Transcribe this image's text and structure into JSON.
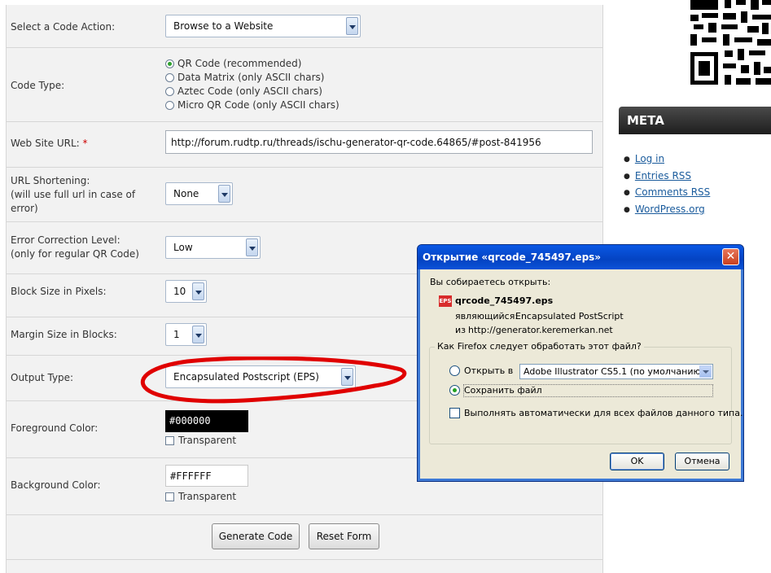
{
  "form": {
    "code_action": {
      "label": "Select a Code Action:",
      "value": "Browse to a Website"
    },
    "code_type": {
      "label": "Code Type:",
      "options": [
        {
          "label": "QR Code (recommended)",
          "selected": true
        },
        {
          "label": "Data Matrix (only ASCII chars)",
          "selected": false
        },
        {
          "label": "Aztec Code (only ASCII chars)",
          "selected": false
        },
        {
          "label": "Micro QR Code (only ASCII chars)",
          "selected": false
        }
      ]
    },
    "website_url": {
      "label": "Web Site URL:",
      "required_mark": "*",
      "value": "http://forum.rudtp.ru/threads/ischu-generator-qr-code.64865/#post-841956"
    },
    "url_shortening": {
      "label_line1": "URL Shortening:",
      "label_line2": "(will use full url in case of",
      "label_line3": "error)",
      "value": "None"
    },
    "error_correction": {
      "label_line1": "Error Correction Level:",
      "label_line2": "(only for regular QR Code)",
      "value": "Low"
    },
    "block_size": {
      "label": "Block Size in Pixels:",
      "value": "10"
    },
    "margin_size": {
      "label": "Margin Size in Blocks:",
      "value": "1"
    },
    "output_type": {
      "label": "Output Type:",
      "value": "Encapsulated Postscript (EPS)"
    },
    "foreground": {
      "label": "Foreground Color:",
      "value": "#000000",
      "transparent_label": "Transparent"
    },
    "background": {
      "label": "Background Color:",
      "value": "#FFFFFF",
      "transparent_label": "Transparent"
    },
    "buttons": {
      "generate": "Generate Code",
      "reset": "Reset Form"
    }
  },
  "sidebar": {
    "meta_title": "META",
    "links": [
      "Log in",
      "Entries RSS",
      "Comments RSS",
      "WordPress.org"
    ]
  },
  "dialog": {
    "title": "Открытие «qrcode_745497.eps»",
    "close_glyph": "✕",
    "about_to_open": "Вы собираетесь открыть:",
    "file_icon_text": "EPS",
    "filename": "qrcode_745497.eps",
    "type_label": "являющийся:",
    "type_value": "Encapsulated PostScript",
    "from_label": "из",
    "from_value": "http://generator.keremerkan.net",
    "question": "Как Firefox следует обработать этот файл?",
    "open_with_label": "Открыть в",
    "open_with_app": "Adobe Illustrator CS5.1 (по умолчанию)",
    "save_file_label": "Сохранить файл",
    "auto_label": "Выполнять автоматически для всех файлов данного типа.",
    "ok": "OK",
    "cancel": "Отмена"
  },
  "colors": {
    "annotation": "#e00000",
    "foreground_swatch": "#000000",
    "background_swatch": "#FFFFFF",
    "dialog_titlebar": "#0a58e5",
    "link": "#1a5b9c"
  }
}
